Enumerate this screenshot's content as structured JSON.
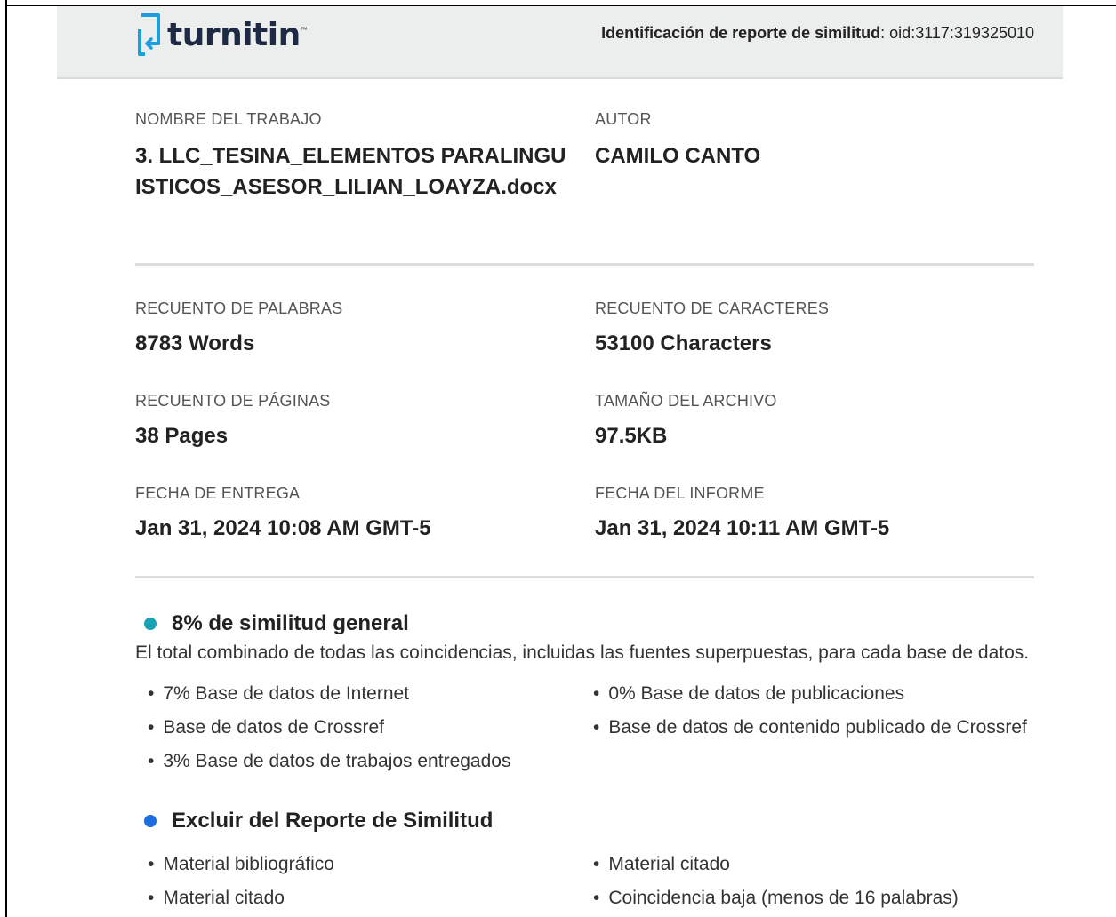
{
  "header": {
    "logo_text": "turnitin",
    "logo_mark": "™",
    "report_id_label": "Identificación de reporte de similitud",
    "report_id_value": ": oid:3117:319325010"
  },
  "submission": {
    "work_name_label": "NOMBRE  DEL TRABAJO",
    "work_name": "3. LLC_TESINA_ELEMENTOS PARALINGUISTICOS_ASESOR_LILIAN_LOAYZA.docx",
    "author_label": "AUTOR",
    "author": "CAMILO CANTO"
  },
  "stats": {
    "word_count_label": "RECUENTO DE PALABRAS",
    "word_count": "8783 Words",
    "char_count_label": "RECUENTO  DE CARACTERES",
    "char_count": "53100 Characters",
    "page_count_label": "RECUENTO  DE PÁGINAS",
    "page_count": "38 Pages",
    "file_size_label": "TAMAÑO DEL ARCHIVO",
    "file_size": "97.5KB",
    "submission_date_label": "FECHA DE ENTREGA",
    "submission_date": "Jan 31, 2024 10:08 AM GMT-5",
    "report_date_label": "FECHA DEL INFORME",
    "report_date": "Jan 31, 2024 10:11 AM GMT-5"
  },
  "similarity": {
    "title": "8% de similitud general",
    "dot_color": "#1aa1b4",
    "description": "El total combinado de todas las coincidencias, incluidas las fuentes superpuestas, para cada base de datos.",
    "items_left": [
      "7% Base de datos de Internet",
      "Base de datos de Crossref",
      "3% Base de datos de trabajos entregados"
    ],
    "items_right": [
      "0% Base de datos de publicaciones",
      "Base de datos de contenido publicado de Crossref"
    ]
  },
  "exclusions": {
    "title": "Excluir  del Reporte de Similitud",
    "dot_color": "#1b6ee0",
    "items_left": [
      "Material bibliográfico",
      "Material citado"
    ],
    "items_right": [
      "Material citado",
      "Coincidencia baja (menos de 16 palabras)"
    ]
  },
  "bullet_char": "•",
  "colors": {
    "header_bg": "#eceded",
    "logo_blue": "#1a9ee0",
    "logo_text": "#1e2a44"
  }
}
